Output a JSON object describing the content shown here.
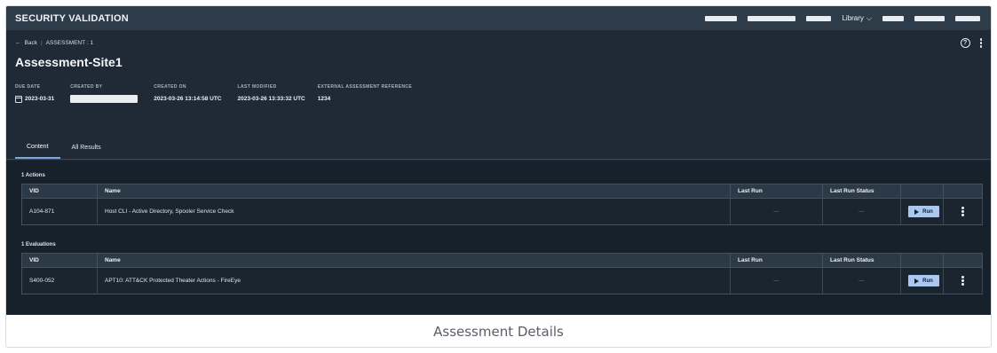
{
  "app": {
    "title": "SECURITY VALIDATION"
  },
  "topnav": {
    "library_label": "Library"
  },
  "breadcrumb": {
    "back_label": "Back",
    "current": "ASSESSMENT : 1"
  },
  "page": {
    "title": "Assessment-Site1"
  },
  "meta": {
    "due_date": {
      "label": "DUE DATE",
      "value": "2023-03-31"
    },
    "created_by": {
      "label": "CREATED BY"
    },
    "created_on": {
      "label": "CREATED ON",
      "value": "2023-03-26 13:14:58 UTC"
    },
    "last_modified": {
      "label": "LAST MODIFIED",
      "value": "2023-03-26 13:33:32 UTC"
    },
    "external_ref": {
      "label": "EXTERNAL ASSESSMENT REFERENCE",
      "value": "1234"
    }
  },
  "tabs": [
    {
      "label": "Content",
      "active": true
    },
    {
      "label": "All Results",
      "active": false
    }
  ],
  "actions": {
    "heading": "1 Actions",
    "columns": [
      "VID",
      "Name",
      "Last Run",
      "Last Run Status"
    ],
    "rows": [
      {
        "vid": "A104-871",
        "name": "Host CLI - Active Directory, Spooler Service Check",
        "last_run": "—",
        "status": "—",
        "run_label": "Run"
      }
    ]
  },
  "evaluations": {
    "heading": "1 Evaluations",
    "columns": [
      "VID",
      "Name",
      "Last Run",
      "Last Run Status"
    ],
    "rows": [
      {
        "vid": "S400-052",
        "name": "APT10: ATT&CK Protected Theater Actions - FireEye",
        "last_run": "—",
        "status": "—",
        "run_label": "Run"
      }
    ]
  },
  "caption": "Assessment Details",
  "colors": {
    "accent": "#79a8e0",
    "run_button": "#a9c7ef",
    "background": "#1f2a36"
  }
}
